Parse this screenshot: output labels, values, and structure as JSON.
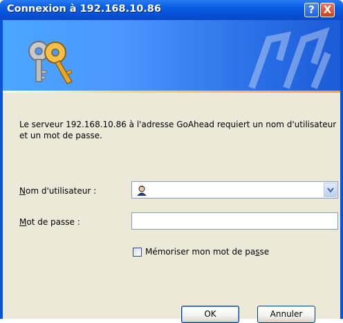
{
  "window": {
    "title": "Connexion à 192.168.10.86",
    "help_glyph": "?",
    "close_glyph": "X"
  },
  "dialog": {
    "message": "Le serveur 192.168.10.86 à l'adresse GoAhead requiert un nom d'utilisateur et un mot de passe.",
    "username_label_first": "N",
    "username_label_rest": "om d'utilisateur :",
    "username_value": "",
    "password_label_first": "M",
    "password_label_rest": "ot de passe :",
    "password_value": "",
    "remember_label_a": "Mémoriser mon mot de pa",
    "remember_label_u": "s",
    "remember_label_b": "se",
    "remember_checked": false,
    "ok_label": "OK",
    "cancel_label": "Annuler"
  },
  "icons": {
    "banner": "keys-icon",
    "user": "user-icon",
    "dropdown": "chevron-down-icon"
  },
  "colors": {
    "titlebar": "#0b5fe3",
    "banner": "#4b96ff",
    "dialog_bg": "#ece9d8",
    "close_button": "#c8401c"
  }
}
